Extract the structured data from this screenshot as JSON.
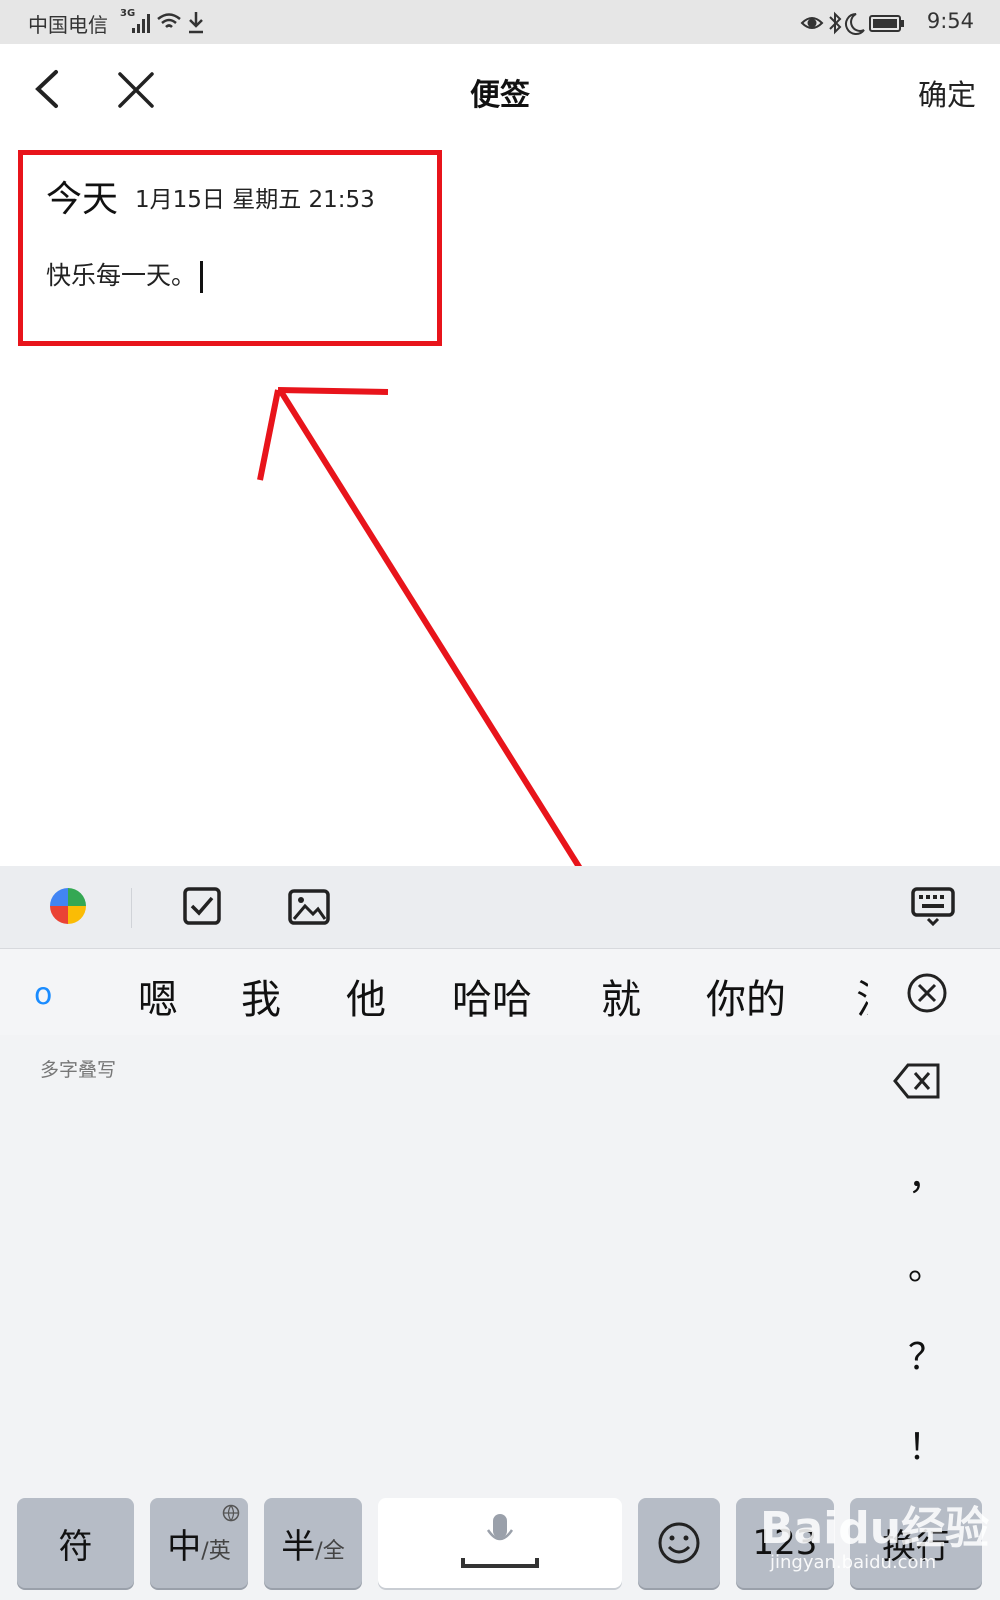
{
  "status_bar": {
    "carrier": "中国电信",
    "network": "3G",
    "time": "9:54"
  },
  "nav": {
    "title": "便签",
    "confirm_label": "确定",
    "back_icon": "chevron-left-icon",
    "close_icon": "close-icon"
  },
  "note": {
    "day_label": "今天",
    "date_text": "1月15日 星期五 21:53",
    "body_text": "快乐每一天。"
  },
  "keyboard": {
    "toolbar_icons": [
      "pie-color-icon",
      "checkbox-icon",
      "image-icon",
      "keyboard-hide-icon"
    ],
    "composing": "o",
    "candidates": [
      "嗯",
      "我",
      "他",
      "哈哈",
      "就",
      "你的",
      "汉"
    ],
    "handwrite_hint": "多字叠写",
    "punctuation": [
      "，",
      "。",
      "？",
      "！"
    ],
    "keys": {
      "symbol": "符",
      "zh": "中",
      "zh_sub": "/英",
      "half": "半",
      "half_sub": "/全",
      "num": "123",
      "enter": "换行"
    }
  },
  "watermark": {
    "brand": "Baidu经验",
    "url": "jingyan.baidu.com"
  },
  "colors": {
    "annotation_red": "#e8141b",
    "composing_blue": "#1a8cff",
    "key_gray": "#b6bcc6"
  }
}
